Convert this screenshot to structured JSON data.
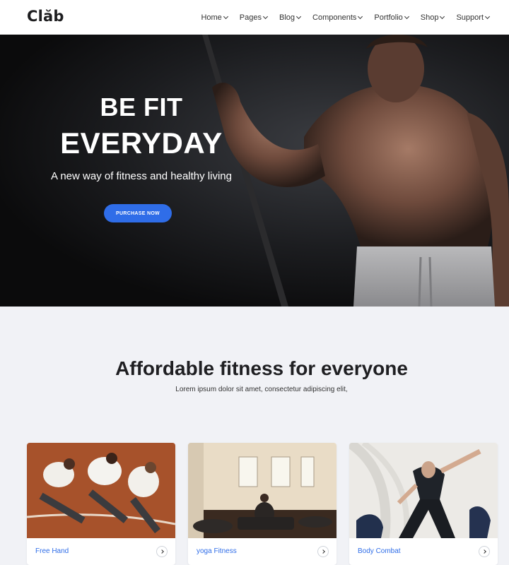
{
  "header": {
    "logo": "Clăb",
    "nav": [
      "Home",
      "Pages",
      "Blog",
      "Components",
      "Portfolio",
      "Shop",
      "Support"
    ]
  },
  "hero": {
    "line1": "BE FIT",
    "line2": "EVERYDAY",
    "subtitle": "A new way of fitness and healthy living",
    "button_label": "PURCHASE NOW"
  },
  "section": {
    "title": "Affordable fitness for everyone",
    "subtitle": "Lorem ipsum dolor sit amet, consectetur adipiscing elit,"
  },
  "cards": [
    {
      "label": "Free Hand"
    },
    {
      "label": "yoga Fitness"
    },
    {
      "label": "Body Combat"
    }
  ],
  "colors": {
    "accent": "#2f6de8",
    "hero_bg": "#1c1d20",
    "page_bg": "#f1f2f6"
  }
}
